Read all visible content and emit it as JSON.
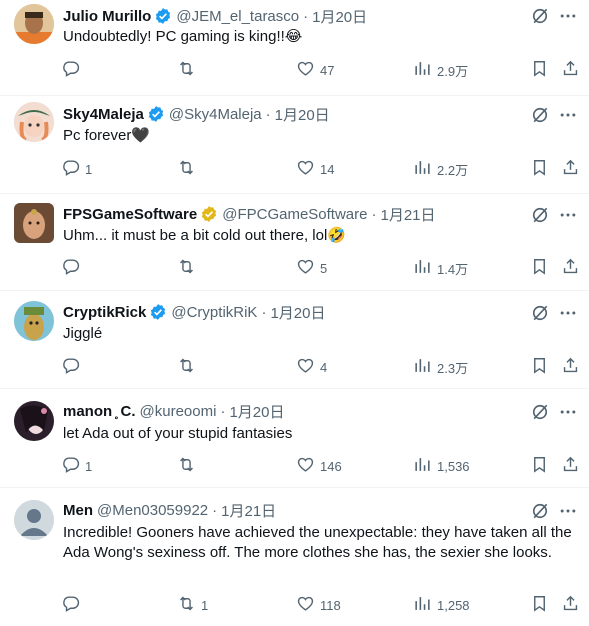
{
  "tweets": [
    {
      "name": "Julio Murillo",
      "handle": "@JEM_el_tarasco",
      "separator": "·",
      "time": "1月20日",
      "verified": "blue",
      "text": "Undoubtedly! PC gaming is king!!",
      "emoji": "😂",
      "replies": "",
      "retweets": "",
      "likes": "47",
      "views": "2.9万"
    },
    {
      "name": "Sky4Maleja",
      "handle": "@Sky4Maleja",
      "separator": "·",
      "time": "1月20日",
      "verified": "blue",
      "text": "Pc forever",
      "emoji": "🖤",
      "replies": "1",
      "retweets": "",
      "likes": "14",
      "views": "2.2万"
    },
    {
      "name": "FPSGameSoftware",
      "handle": "@FPCGameSoftware",
      "separator": "·",
      "time": "1月21日",
      "verified": "gold",
      "text": "Uhm... it must be a bit cold out there, lol",
      "emoji": "🤣",
      "replies": "",
      "retweets": "",
      "likes": "5",
      "views": "1.4万"
    },
    {
      "name": "CryptikRick",
      "handle": "@CryptikRiK",
      "separator": "·",
      "time": "1月20日",
      "verified": "blue",
      "text": "Jigglé",
      "emoji": "",
      "replies": "",
      "retweets": "",
      "likes": "4",
      "views": "2.3万"
    },
    {
      "name": "manon ̥̥ C.",
      "handle": "@kureoomi",
      "separator": "·",
      "time": "1月20日",
      "verified": "none",
      "text": "let Ada out of your stupid fantasies",
      "emoji": "",
      "replies": "1",
      "retweets": "",
      "likes": "146",
      "views": "1,536"
    },
    {
      "name": "Men",
      "handle": "@Men03059922",
      "separator": "·",
      "time": "1月21日",
      "verified": "none",
      "text": "Incredible! Gooners have achieved the unexpectable: they have taken all the Ada Wong's sexiness off. The more clothes she has, the sexier she looks.",
      "emoji": "",
      "replies": "",
      "retweets": "1",
      "likes": "118",
      "views": "1,258"
    }
  ],
  "colors": {
    "text": "#0f1419",
    "muted": "#536471",
    "verified_blue": "#1d9bf0",
    "verified_gold": "#e2b719",
    "divider": "#eff3f4"
  },
  "icons": [
    "grok-icon",
    "more-icon",
    "reply-icon",
    "retweet-icon",
    "like-icon",
    "views-icon",
    "bookmark-icon",
    "share-icon",
    "verified-badge-icon",
    "avatar-default-icon"
  ]
}
